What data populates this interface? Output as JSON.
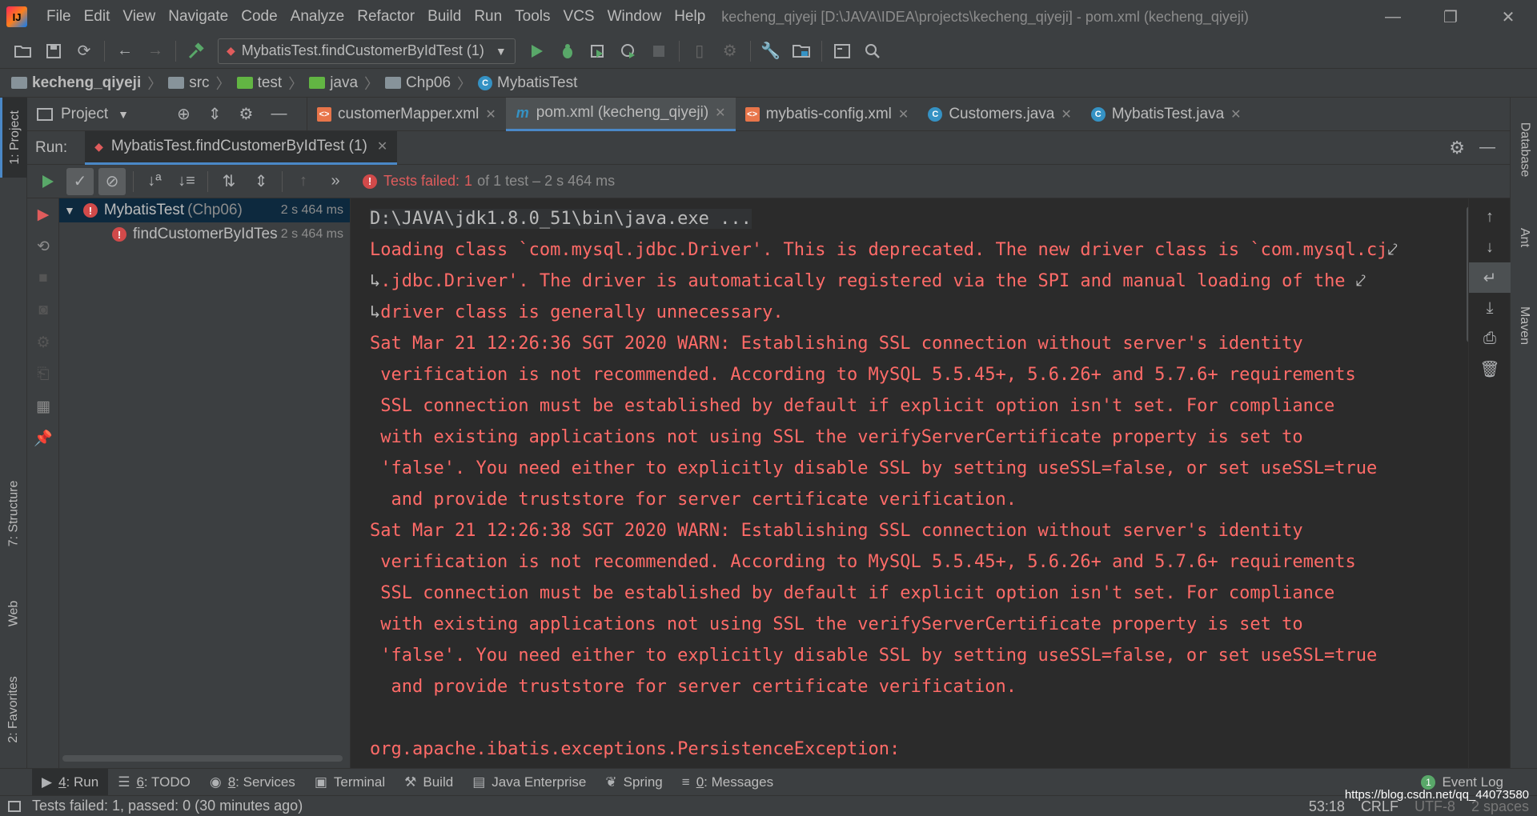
{
  "window": {
    "app_logo": "IJ",
    "title": "kecheng_qiyeji [D:\\JAVA\\IDEA\\projects\\kecheng_qiyeji] - pom.xml (kecheng_qiyeji)",
    "minimize": "—",
    "restore": "❐",
    "close": "✕"
  },
  "menu": [
    "File",
    "Edit",
    "View",
    "Navigate",
    "Code",
    "Analyze",
    "Refactor",
    "Build",
    "Run",
    "Tools",
    "VCS",
    "Window",
    "Help"
  ],
  "toolbar": {
    "run_config": "MybatisTest.findCustomerByIdTest (1)"
  },
  "breadcrumb": [
    "kecheng_qiyeji",
    "src",
    "test",
    "java",
    "Chp06",
    "MybatisTest"
  ],
  "left_strip": {
    "project": "1: Project",
    "structure": "7: Structure",
    "web": "Web",
    "favorites": "2: Favorites"
  },
  "right_strip": {
    "database": "Database",
    "ant": "Ant",
    "maven": "Maven"
  },
  "project_pane": {
    "label": "Project"
  },
  "editor_tabs": [
    {
      "label": "customerMapper.xml",
      "type": "xml",
      "color": "#e8754a",
      "glyph": "<>"
    },
    {
      "label": "pom.xml (kecheng_qiyeji)",
      "type": "maven",
      "color": "#3592c4",
      "glyph": "m",
      "active": true
    },
    {
      "label": "mybatis-config.xml",
      "type": "xml",
      "color": "#e8754a",
      "glyph": "<>"
    },
    {
      "label": "Customers.java",
      "type": "class",
      "color": "#3592c4",
      "glyph": "C"
    },
    {
      "label": "MybatisTest.java",
      "type": "test",
      "color": "#3592c4",
      "glyph": "C"
    }
  ],
  "run_panel": {
    "label": "Run:",
    "tab": "MybatisTest.findCustomerByIdTest (1)",
    "status_prefix": "Tests failed:",
    "status_count": "1",
    "status_suffix": "of 1 test – 2 s 464 ms"
  },
  "test_tree": [
    {
      "name": "MybatisTest",
      "pkg": "(Chp06)",
      "time": "2 s 464 ms"
    },
    {
      "name": "findCustomerByIdTes",
      "time": "2 s 464 ms"
    }
  ],
  "console": {
    "cmd": "D:\\JAVA\\jdk1.8.0_51\\bin\\java.exe ...",
    "lines": [
      "Loading class `com.mysql.jdbc.Driver'. This is deprecated. The new driver class is `com.mysql.cj",
      ".jdbc.Driver'. The driver is automatically registered via the SPI and manual loading of the",
      "driver class is generally unnecessary.",
      "Sat Mar 21 12:26:36 SGT 2020 WARN: Establishing SSL connection without server's identity",
      " verification is not recommended. According to MySQL 5.5.45+, 5.6.26+ and 5.7.6+ requirements",
      " SSL connection must be established by default if explicit option isn't set. For compliance",
      " with existing applications not using SSL the verifyServerCertificate property is set to",
      " 'false'. You need either to explicitly disable SSL by setting useSSL=false, or set useSSL=true",
      "  and provide truststore for server certificate verification.",
      "Sat Mar 21 12:26:38 SGT 2020 WARN: Establishing SSL connection without server's identity",
      " verification is not recommended. According to MySQL 5.5.45+, 5.6.26+ and 5.7.6+ requirements",
      " SSL connection must be established by default if explicit option isn't set. For compliance",
      " with existing applications not using SSL the verifyServerCertificate property is set to",
      " 'false'. You need either to explicitly disable SSL by setting useSSL=false, or set useSSL=true",
      "  and provide truststore for server certificate verification.",
      "",
      "org.apache.ibatis.exceptions.PersistenceException:"
    ]
  },
  "bottom_tabs": [
    {
      "num": "4",
      "label": ": Run",
      "active": true
    },
    {
      "num": "6",
      "label": ": TODO"
    },
    {
      "num": "8",
      "label": ": Services"
    },
    {
      "num": "",
      "label": "Terminal"
    },
    {
      "num": "",
      "label": "Build"
    },
    {
      "num": "",
      "label": "Java Enterprise"
    },
    {
      "num": "",
      "label": "Spring"
    },
    {
      "num": "0",
      "label": ": Messages"
    }
  ],
  "event_log": {
    "count": "1",
    "label": "Event Log"
  },
  "status": {
    "message": "Tests failed: 1, passed: 0 (30 minutes ago)",
    "position": "53:18",
    "line_sep": "CRLF",
    "encoding": "UTF-8",
    "indent": "2 spaces",
    "watermark": "https://blog.csdn.net/qq_44073580"
  },
  "colors": {
    "error_red": "#ff6b68",
    "accent_blue": "#4a88c7",
    "run_green": "#59a869"
  }
}
